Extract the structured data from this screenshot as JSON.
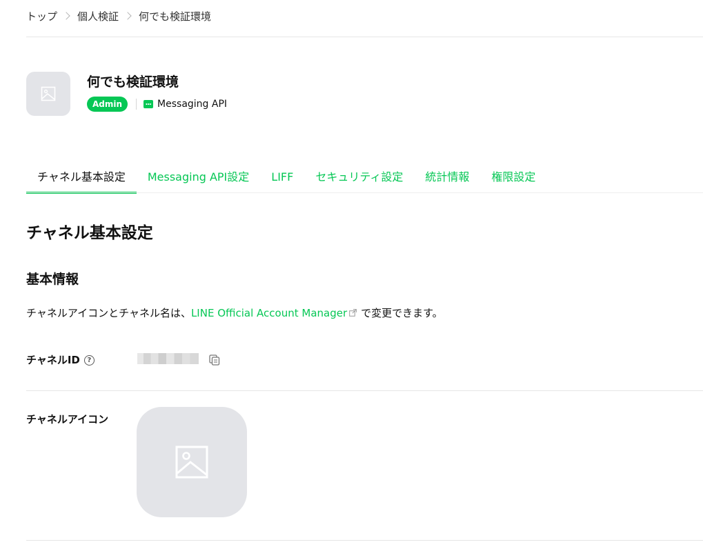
{
  "breadcrumb": [
    "トップ",
    "個人検証",
    "何でも検証環境"
  ],
  "header": {
    "channel_name": "何でも検証環境",
    "role_badge": "Admin",
    "channel_type": "Messaging API"
  },
  "tabs": [
    {
      "label": "チャネル基本設定",
      "active": true
    },
    {
      "label": "Messaging API設定",
      "active": false
    },
    {
      "label": "LIFF",
      "active": false
    },
    {
      "label": "セキュリティ設定",
      "active": false
    },
    {
      "label": "統計情報",
      "active": false
    },
    {
      "label": "権限設定",
      "active": false
    }
  ],
  "page_title": "チャネル基本設定",
  "section_title": "基本情報",
  "description": {
    "prefix": "チャネルアイコンとチャネル名は、",
    "link": "LINE Official Account Manager",
    "suffix": "で変更できます。"
  },
  "fields": {
    "channel_id_label": "チャネルID",
    "help_glyph": "?",
    "channel_icon_label": "チャネルアイコン"
  },
  "colors": {
    "accent": "#06c755",
    "placeholder_bg": "#e3e4e8"
  },
  "icons": [
    "chevron-right-icon",
    "image-placeholder-icon",
    "chat-bubble-icon",
    "external-link-icon",
    "help-icon",
    "copy-icon"
  ]
}
